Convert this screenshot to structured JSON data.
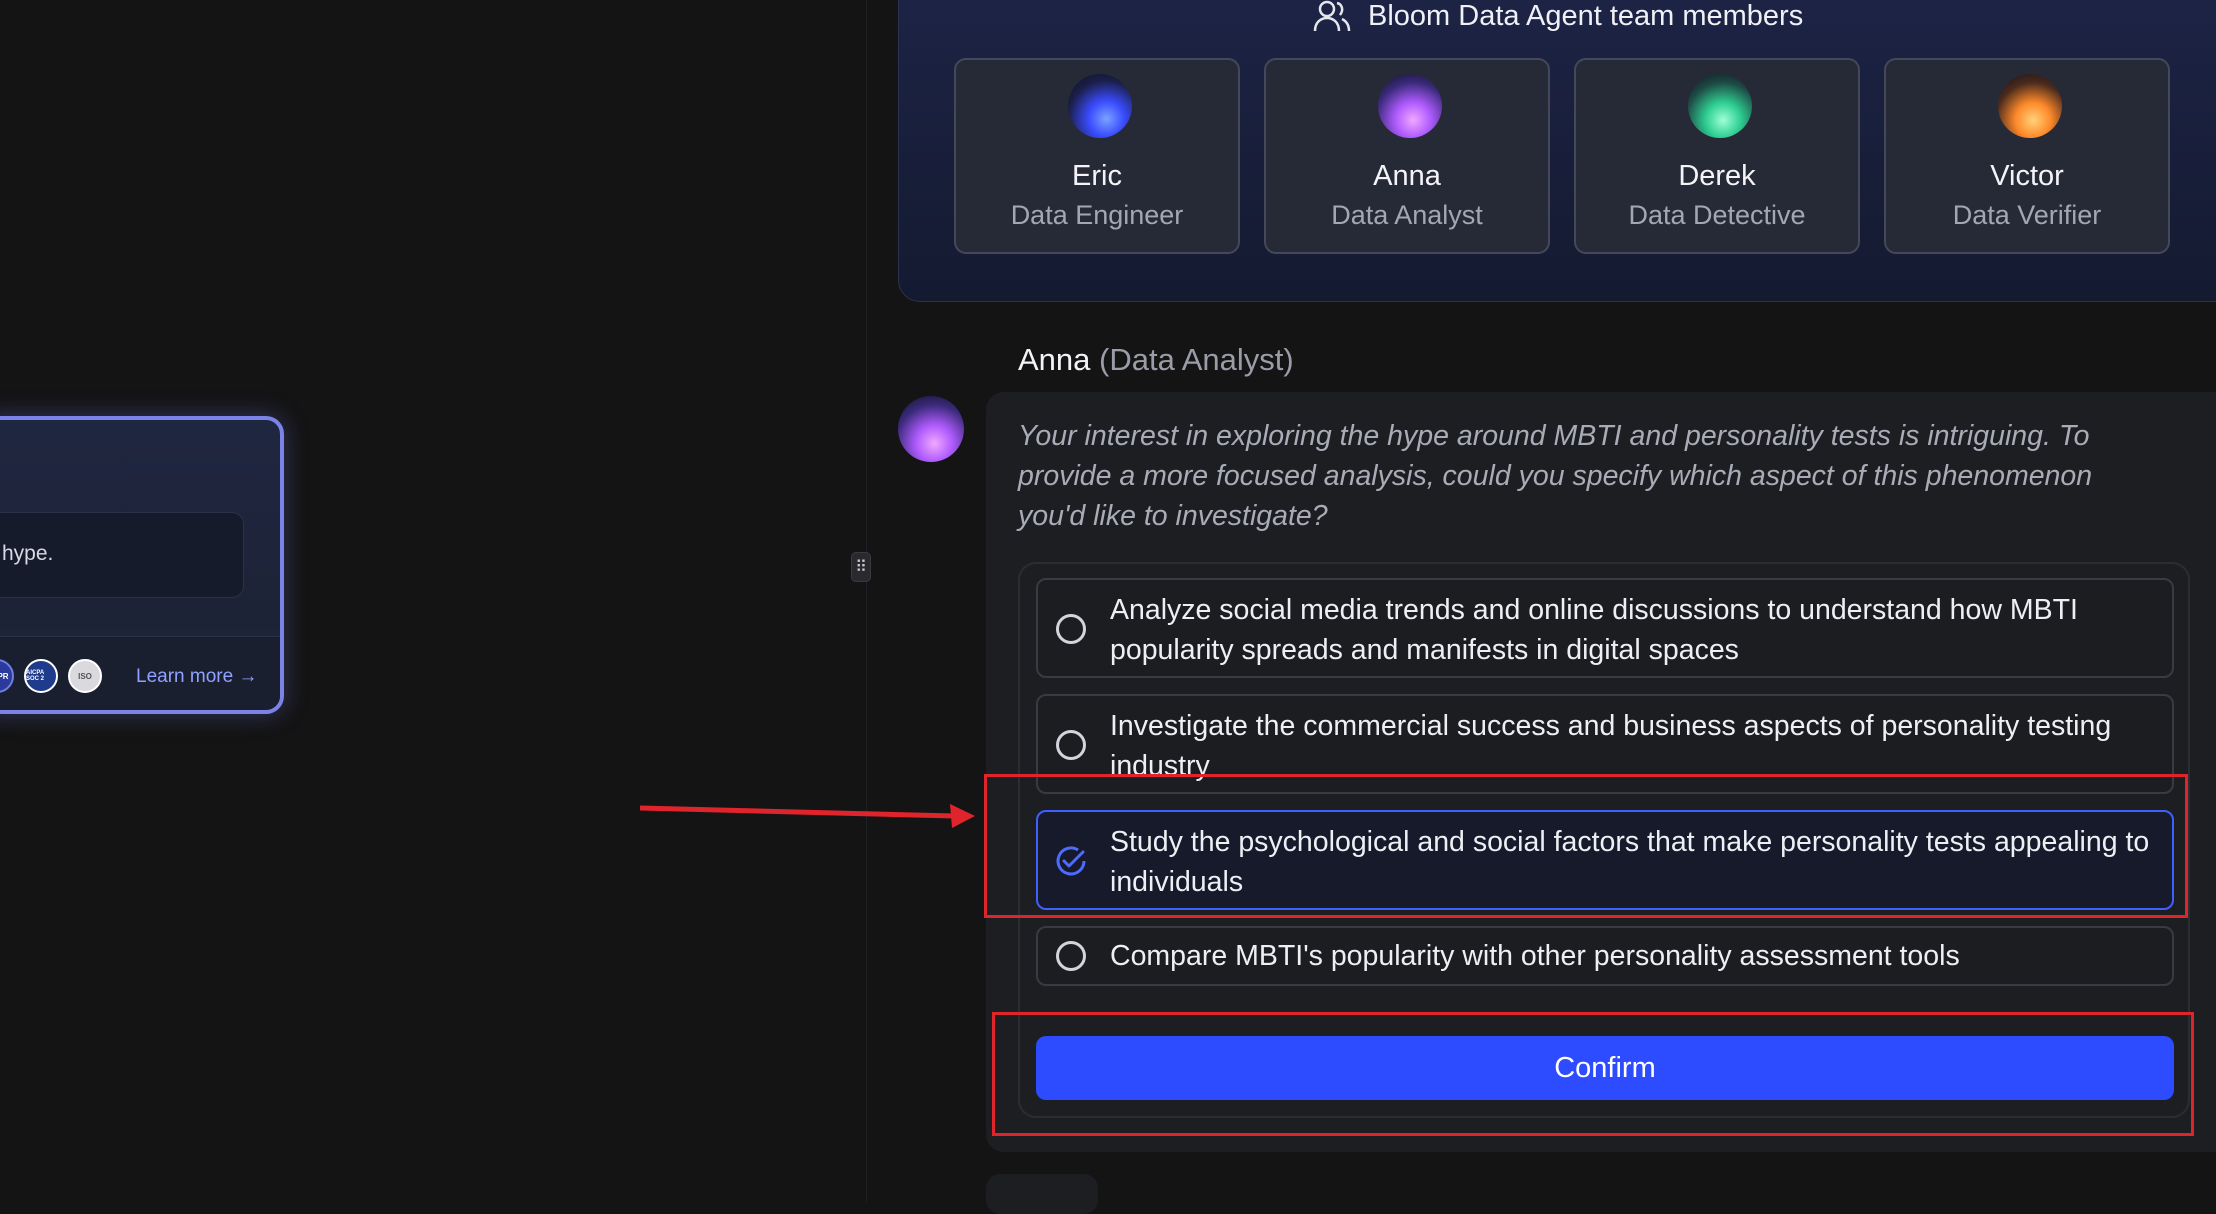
{
  "left_panel": {
    "prompt_text": "hype.",
    "badges": [
      "GDPR",
      "AICPA SOC 2",
      "ISO"
    ],
    "learn_more": "Learn more →"
  },
  "team": {
    "title": "Bloom Data Agent team members",
    "members": [
      {
        "name": "Eric",
        "role": "Data Engineer"
      },
      {
        "name": "Anna",
        "role": "Data Analyst"
      },
      {
        "name": "Derek",
        "role": "Data Detective"
      },
      {
        "name": "Victor",
        "role": "Data Verifier"
      }
    ]
  },
  "message": {
    "agent_name": "Anna",
    "agent_role": "(Data Analyst)",
    "text": "Your interest in exploring the hype around MBTI and personality tests is intriguing. To provide a more focused analysis, could you specify which aspect of this phenomenon you'd like to investigate?",
    "options": [
      {
        "label": "Analyze social media trends and online discussions to understand how MBTI popularity spreads and manifests in digital spaces",
        "selected": false
      },
      {
        "label": "Investigate the commercial success and business aspects of personality testing industry",
        "selected": false
      },
      {
        "label": "Study the psychological and social factors that make personality tests appealing to individuals",
        "selected": true
      },
      {
        "label": "Compare MBTI's popularity with other personality assessment tools",
        "selected": false
      }
    ],
    "confirm_label": "Confirm"
  },
  "handle_glyph": "⠿",
  "colors": {
    "accent": "#2d4bff",
    "annotation_red": "#e0242c"
  }
}
